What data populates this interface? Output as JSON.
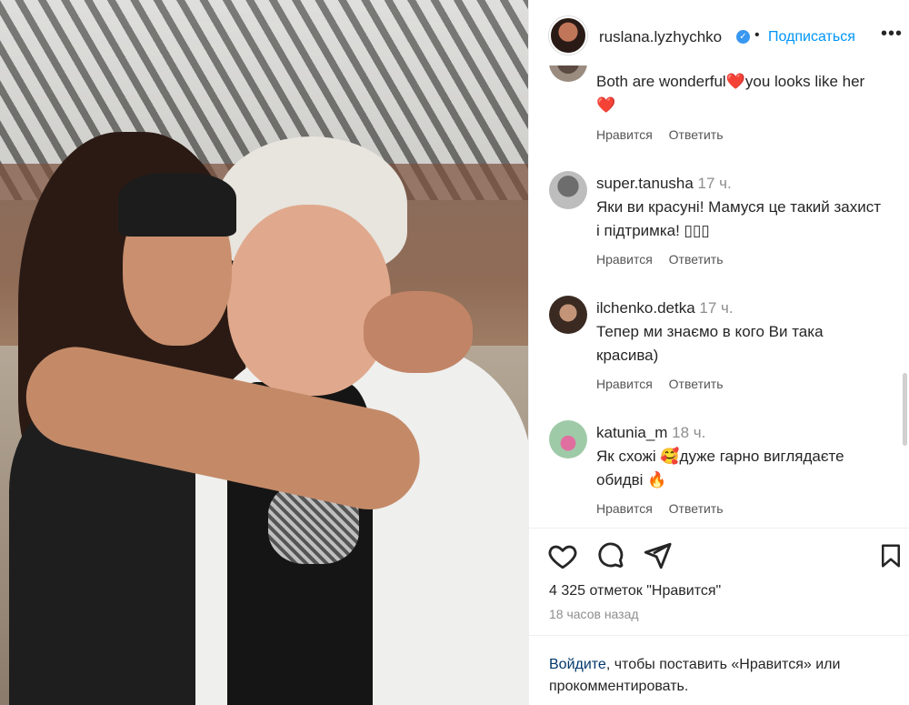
{
  "post": {
    "username": "ruslana.lyzhychko",
    "verified_icon": "verified-badge-icon",
    "separator": "•",
    "follow_label": "Подписаться",
    "more_label": "•••"
  },
  "comments": [
    {
      "username": "",
      "time": "",
      "text": "Both are wonderful❤️you looks like her ❤️",
      "like_label": "Нравится",
      "reply_label": "Ответить"
    },
    {
      "username": "super.tanusha",
      "time": "17 ч.",
      "text": "Яки ви красуні! Мамуся це такий захист і підтримка! ▯▯▯",
      "like_label": "Нравится",
      "reply_label": "Ответить"
    },
    {
      "username": "ilchenko.detka",
      "time": "17 ч.",
      "text": "Тепер ми знаємо в кого Ви така красива)",
      "like_label": "Нравится",
      "reply_label": "Ответить"
    },
    {
      "username": "katunia_m",
      "time": "18 ч.",
      "text": "Як схожі 🥰дуже гарно виглядаєте обидві 🔥",
      "like_label": "Нравится",
      "reply_label": "Ответить"
    }
  ],
  "actions": {
    "like_icon": "heart-icon",
    "comment_icon": "comment-icon",
    "share_icon": "share-icon",
    "save_icon": "bookmark-icon"
  },
  "likes_text": "4 325 отметок \"Нравится\"",
  "posted_time": "18 часов назад",
  "login": {
    "link": "Войдите",
    "rest": ", чтобы поставить «Нравится» или прокомментировать."
  },
  "colors": {
    "link_blue": "#0095f6",
    "verified_blue": "#3897f0",
    "text": "#262626",
    "muted": "#8e8e8e"
  }
}
